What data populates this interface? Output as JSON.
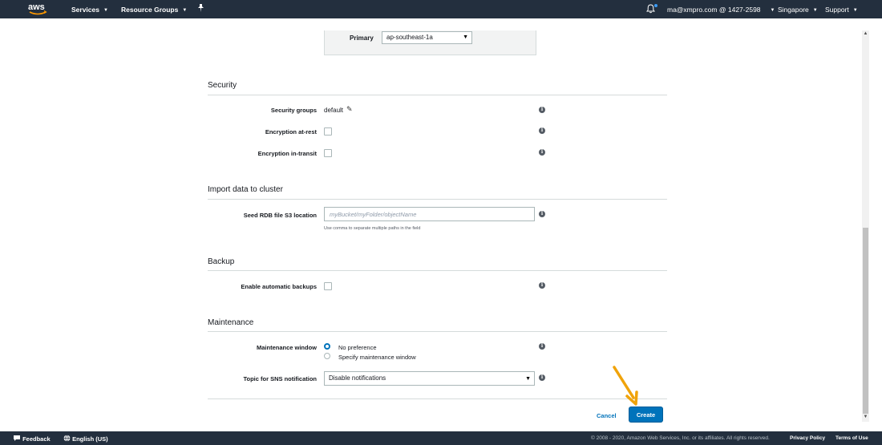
{
  "topnav": {
    "brand": "aws",
    "services_label": "Services",
    "resource_groups_label": "Resource Groups",
    "account_email": "ma@xmpro.com",
    "account_sep": "@",
    "account_id": "1427-2598",
    "region_label": "Singapore",
    "support_label": "Support"
  },
  "primary": {
    "label": "Primary",
    "value": "ap-southeast-1a"
  },
  "security": {
    "title": "Security",
    "groups_label": "Security groups",
    "groups_value": "default",
    "encryption_rest_label": "Encryption at-rest",
    "encryption_transit_label": "Encryption in-transit"
  },
  "import": {
    "title": "Import data to cluster",
    "seed_label": "Seed RDB file S3 location",
    "seed_placeholder": "myBucket/myFolder/objectName",
    "seed_hint": "Use comma to separate multiple paths in the field"
  },
  "backup": {
    "title": "Backup",
    "auto_label": "Enable automatic backups"
  },
  "maintenance": {
    "title": "Maintenance",
    "window_label": "Maintenance window",
    "option_none": "No preference",
    "option_specify": "Specify maintenance window",
    "sns_label": "Topic for SNS notification",
    "sns_value": "Disable notifications"
  },
  "actions": {
    "cancel_label": "Cancel",
    "create_label": "Create"
  },
  "footer": {
    "feedback_label": "Feedback",
    "language_label": "English (US)",
    "copyright": "© 2008 - 2020, Amazon Web Services, Inc. or its affiliates. All rights reserved.",
    "privacy_label": "Privacy Policy",
    "terms_label": "Terms of Use"
  },
  "colors": {
    "nav_bg": "#232f3e",
    "primary_blue": "#0073bb",
    "arrow_orange": "#f0a30a"
  },
  "icons": [
    "aws-logo-icon",
    "pin-icon",
    "bell-icon",
    "info-icon",
    "pencil-icon",
    "chat-icon",
    "globe-icon"
  ]
}
